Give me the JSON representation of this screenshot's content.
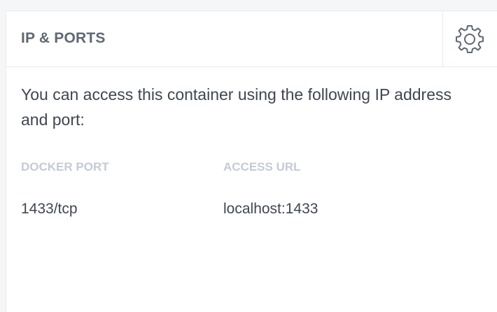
{
  "panel": {
    "title": "IP & PORTS",
    "settings_icon": "gear-icon",
    "description": "You can access this container using the following IP address and port:"
  },
  "ports_table": {
    "headers": [
      "DOCKER PORT",
      "ACCESS URL"
    ],
    "rows": [
      [
        "1433/tcp",
        "localhost:1433"
      ]
    ]
  },
  "colors": {
    "title": "#5f6874",
    "body_text": "#3f4650",
    "column_header": "#c4cbd4",
    "border": "#e6e9ee",
    "background": "#f5f6f8"
  }
}
